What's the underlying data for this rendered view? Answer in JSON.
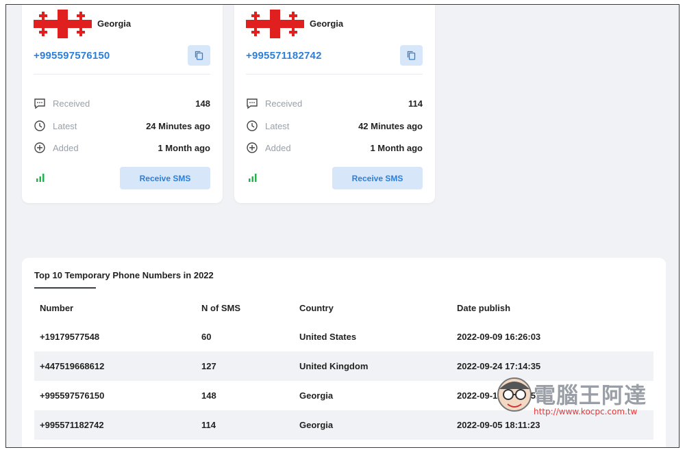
{
  "cards": [
    {
      "country": "Georgia",
      "phone": "+995597576150",
      "received_label": "Received",
      "received_value": "148",
      "latest_label": "Latest",
      "latest_value": "24 Minutes ago",
      "added_label": "Added",
      "added_value": "1 Month ago",
      "button_label": "Receive SMS"
    },
    {
      "country": "Georgia",
      "phone": "+995571182742",
      "received_label": "Received",
      "received_value": "114",
      "latest_label": "Latest",
      "latest_value": "42 Minutes ago",
      "added_label": "Added",
      "added_value": "1 Month ago",
      "button_label": "Receive SMS"
    }
  ],
  "table": {
    "title": "Top 10 Temporary Phone Numbers in 2022",
    "headers": [
      "Number",
      "N of SMS",
      "Country",
      "Date publish"
    ],
    "rows": [
      [
        "+19179577548",
        "60",
        "United States",
        "2022-09-09 16:26:03"
      ],
      [
        "+447519668612",
        "127",
        "United Kingdom",
        "2022-09-24 17:14:35"
      ],
      [
        "+995597576150",
        "148",
        "Georgia",
        "2022-09-12 05:55:52"
      ],
      [
        "+995571182742",
        "114",
        "Georgia",
        "2022-09-05 18:11:23"
      ]
    ]
  },
  "watermark": {
    "title": "電腦王阿達",
    "url": "http://www.kocpc.com.tw"
  },
  "colors": {
    "accent": "#2b7fd9",
    "button_bg": "#d7e6f8",
    "flag_red": "#e0201f",
    "signal_green": "#22b34c",
    "page_bg": "#f1f2f5"
  },
  "icons": [
    "georgia-flag-icon",
    "copy-icon",
    "message-icon",
    "clock-icon",
    "plus-circle-icon",
    "signal-icon"
  ]
}
